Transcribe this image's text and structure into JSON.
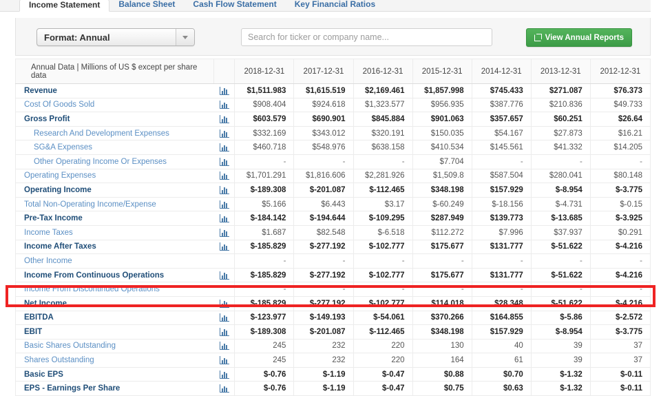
{
  "tabs": [
    {
      "label": "Income Statement",
      "active": true
    },
    {
      "label": "Balance Sheet",
      "active": false
    },
    {
      "label": "Cash Flow Statement",
      "active": false
    },
    {
      "label": "Key Financial Ratios",
      "active": false
    }
  ],
  "toolbar": {
    "format_label": "Format: Annual",
    "search_placeholder": "Search for ticker or company name...",
    "search_value": "",
    "reports_button": "View Annual Reports",
    "reports_icon": "external-link-icon",
    "caret_icon": "chevron-down-icon"
  },
  "table": {
    "row_header": "Annual Data | Millions of US $ except per share data",
    "chart_icon": "bar-chart-icon",
    "columns": [
      "2018-12-31",
      "2017-12-31",
      "2016-12-31",
      "2015-12-31",
      "2014-12-31",
      "2013-12-31",
      "2012-12-31"
    ],
    "rows": [
      {
        "label": "Revenue",
        "style": "bold",
        "icon": true,
        "values": [
          "$1,511.983",
          "$1,615.519",
          "$2,169.461",
          "$1,857.998",
          "$745.433",
          "$271.087",
          "$76.373"
        ]
      },
      {
        "label": "Cost Of Goods Sold",
        "style": "normal",
        "icon": true,
        "values": [
          "$908.404",
          "$924.618",
          "$1,323.577",
          "$956.935",
          "$387.776",
          "$210.836",
          "$49.733"
        ]
      },
      {
        "label": "Gross Profit",
        "style": "bold",
        "icon": true,
        "values": [
          "$603.579",
          "$690.901",
          "$845.884",
          "$901.063",
          "$357.657",
          "$60.251",
          "$26.64"
        ]
      },
      {
        "label": "Research And Development Expenses",
        "style": "indent",
        "icon": true,
        "values": [
          "$332.169",
          "$343.012",
          "$320.191",
          "$150.035",
          "$54.167",
          "$27.873",
          "$16.21"
        ]
      },
      {
        "label": "SG&A Expenses",
        "style": "indent",
        "icon": true,
        "values": [
          "$460.718",
          "$548.976",
          "$638.158",
          "$410.534",
          "$145.561",
          "$41.332",
          "$14.205"
        ]
      },
      {
        "label": "Other Operating Income Or Expenses",
        "style": "indent",
        "icon": true,
        "values": [
          "-",
          "-",
          "-",
          "$7.704",
          "-",
          "-",
          "-"
        ]
      },
      {
        "label": "Operating Expenses",
        "style": "normal",
        "icon": true,
        "values": [
          "$1,701.291",
          "$1,816.606",
          "$2,281.926",
          "$1,509.8",
          "$587.504",
          "$280.041",
          "$80.148"
        ]
      },
      {
        "label": "Operating Income",
        "style": "bold",
        "icon": true,
        "values": [
          "$-189.308",
          "$-201.087",
          "$-112.465",
          "$348.198",
          "$157.929",
          "$-8.954",
          "$-3.775"
        ]
      },
      {
        "label": "Total Non-Operating Income/Expense",
        "style": "normal",
        "icon": true,
        "values": [
          "$5.166",
          "$6.443",
          "$3.17",
          "$-60.249",
          "$-18.156",
          "$-4.731",
          "$-0.15"
        ]
      },
      {
        "label": "Pre-Tax Income",
        "style": "bold",
        "icon": true,
        "values": [
          "$-184.142",
          "$-194.644",
          "$-109.295",
          "$287.949",
          "$139.773",
          "$-13.685",
          "$-3.925"
        ]
      },
      {
        "label": "Income Taxes",
        "style": "normal",
        "icon": true,
        "values": [
          "$1.687",
          "$82.548",
          "$-6.518",
          "$112.272",
          "$7.996",
          "$37.937",
          "$0.291"
        ]
      },
      {
        "label": "Income After Taxes",
        "style": "bold",
        "icon": true,
        "values": [
          "$-185.829",
          "$-277.192",
          "$-102.777",
          "$175.677",
          "$131.777",
          "$-51.622",
          "$-4.216"
        ]
      },
      {
        "label": "Other Income",
        "style": "normal",
        "icon": false,
        "values": [
          "-",
          "-",
          "-",
          "-",
          "-",
          "-",
          "-"
        ]
      },
      {
        "label": "Income From Continuous Operations",
        "style": "bold",
        "icon": true,
        "values": [
          "$-185.829",
          "$-277.192",
          "$-102.777",
          "$175.677",
          "$131.777",
          "$-51.622",
          "$-4.216"
        ]
      },
      {
        "label": "Income From Discontinued Operations",
        "style": "normal",
        "icon": false,
        "values": [
          "-",
          "-",
          "-",
          "-",
          "-",
          "-",
          "-"
        ]
      },
      {
        "label": "Net Income",
        "style": "bold",
        "icon": true,
        "highlighted": true,
        "values": [
          "$-185.829",
          "$-277.192",
          "$-102.777",
          "$114.018",
          "$28.348",
          "$-51.622",
          "$-4.216"
        ]
      },
      {
        "label": "EBITDA",
        "style": "bold",
        "icon": true,
        "values": [
          "$-123.977",
          "$-149.193",
          "$-54.061",
          "$370.266",
          "$164.855",
          "$-5.86",
          "$-2.572"
        ]
      },
      {
        "label": "EBIT",
        "style": "bold",
        "icon": true,
        "values": [
          "$-189.308",
          "$-201.087",
          "$-112.465",
          "$348.198",
          "$157.929",
          "$-8.954",
          "$-3.775"
        ]
      },
      {
        "label": "Basic Shares Outstanding",
        "style": "normal",
        "icon": true,
        "values": [
          "245",
          "232",
          "220",
          "130",
          "40",
          "39",
          "37"
        ]
      },
      {
        "label": "Shares Outstanding",
        "style": "normal",
        "icon": true,
        "values": [
          "245",
          "232",
          "220",
          "164",
          "61",
          "39",
          "37"
        ]
      },
      {
        "label": "Basic EPS",
        "style": "bold",
        "icon": true,
        "values": [
          "$-0.76",
          "$-1.19",
          "$-0.47",
          "$0.88",
          "$0.70",
          "$-1.32",
          "$-0.11"
        ]
      },
      {
        "label": "EPS - Earnings Per Share",
        "style": "bold",
        "icon": true,
        "values": [
          "$-0.76",
          "$-1.19",
          "$-0.47",
          "$0.75",
          "$0.63",
          "$-1.32",
          "$-0.11"
        ]
      }
    ]
  },
  "annotation": {
    "highlight_color": "#ef2323",
    "highlight_row": "Net Income"
  }
}
